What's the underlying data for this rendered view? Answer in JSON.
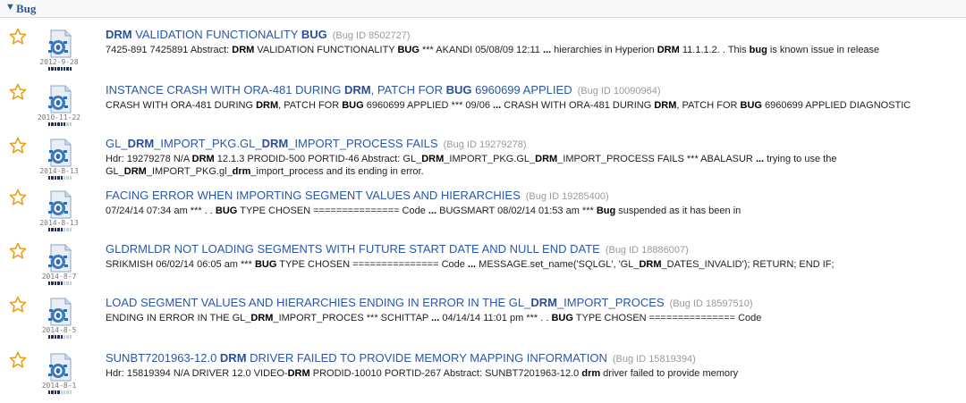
{
  "header": {
    "toggle": "▼",
    "title": "Bug"
  },
  "results": [
    {
      "title": [
        [
          "DRM",
          true
        ],
        [
          " VALIDATION FUNCTIONALITY ",
          false
        ],
        [
          "BUG",
          true
        ]
      ],
      "bug_id": "(Bug ID 8502727)",
      "date": "2012-9-28",
      "relevance": 8,
      "snippet": [
        [
          "7425-891 7425891 Abstract: ",
          false
        ],
        [
          "DRM",
          true
        ],
        [
          " VALIDATION FUNCTIONALITY ",
          false
        ],
        [
          "BUG",
          true
        ],
        [
          " *** AKANDI 05/08/09 12:11 ",
          false
        ],
        [
          "...",
          true
        ],
        [
          " hierarchies in Hyperion ",
          false
        ],
        [
          "DRM",
          true
        ],
        [
          " 11.1.1.2. . This ",
          false
        ],
        [
          "bug",
          true
        ],
        [
          " is known issue in release",
          false
        ]
      ]
    },
    {
      "title": [
        [
          "INSTANCE CRASH WITH ORA-481 DURING ",
          false
        ],
        [
          "DRM",
          true
        ],
        [
          ", PATCH FOR ",
          false
        ],
        [
          "BUG",
          true
        ],
        [
          " 6960699 APPLIED",
          false
        ]
      ],
      "bug_id": "(Bug ID 10090964)",
      "date": "2010-11-22",
      "relevance": 6,
      "snippet": [
        [
          "CRASH WITH ORA-481 DURING ",
          false
        ],
        [
          "DRM",
          true
        ],
        [
          ", PATCH FOR ",
          false
        ],
        [
          "BUG",
          true
        ],
        [
          " 6960699 APPLIED *** 09/06 ",
          false
        ],
        [
          "...",
          true
        ],
        [
          " CRASH WITH ORA-481 DURING ",
          false
        ],
        [
          "DRM",
          true
        ],
        [
          ", PATCH FOR ",
          false
        ],
        [
          "BUG",
          true
        ],
        [
          " 6960699 APPLIED DIAGNOSTIC",
          false
        ]
      ]
    },
    {
      "title": [
        [
          "GL_",
          false
        ],
        [
          "DRM",
          true
        ],
        [
          "_IMPORT_PKG.GL_",
          false
        ],
        [
          "DRM",
          true
        ],
        [
          "_IMPORT_PROCESS FAILS",
          false
        ]
      ],
      "bug_id": "(Bug ID 19279278)",
      "date": "2014-8-13",
      "relevance": 5,
      "snippet": [
        [
          "Hdr: 19279278 N/A ",
          false
        ],
        [
          "DRM",
          true
        ],
        [
          " 12.1.3 PRODID-500 PORTID-46 Abstract: GL_",
          false
        ],
        [
          "DRM",
          true
        ],
        [
          "_IMPORT_PKG.GL_",
          false
        ],
        [
          "DRM",
          true
        ],
        [
          "_IMPORT_PROCESS FAILS *** ABALASUR ",
          false
        ],
        [
          "...",
          true
        ],
        [
          " trying to use the GL_",
          false
        ],
        [
          "DRM",
          true
        ],
        [
          "_IMPORT_PKG.gl_",
          false
        ],
        [
          "drm",
          true
        ],
        [
          "_import_process and its ending in error.",
          false
        ]
      ]
    },
    {
      "title": [
        [
          "FACING ERROR WHEN IMPORTING SEGMENT VALUES AND HIERARCHIES",
          false
        ]
      ],
      "bug_id": "(Bug ID 19285400)",
      "date": "2014-8-13",
      "relevance": 5,
      "snippet": [
        [
          "07/24/14 07:34 am *** . . ",
          false
        ],
        [
          "BUG",
          true
        ],
        [
          " TYPE CHOSEN =============== Code ",
          false
        ],
        [
          "...",
          true
        ],
        [
          " BUGSMART 08/02/14 01:53 am *** ",
          false
        ],
        [
          "Bug",
          true
        ],
        [
          " suspended as it has been in",
          false
        ]
      ]
    },
    {
      "title": [
        [
          "GLDRMLDR NOT LOADING SEGMENTS WITH FUTURE START DATE AND NULL END DATE",
          false
        ]
      ],
      "bug_id": "(Bug ID 18886007)",
      "date": "2014-8-7",
      "relevance": 5,
      "snippet": [
        [
          "SRIKMISH 06/02/14 06:05 am *** ",
          false
        ],
        [
          "BUG",
          true
        ],
        [
          " TYPE CHOSEN =============== Code ",
          false
        ],
        [
          "...",
          true
        ],
        [
          " MESSAGE.set_name('SQLGL', 'GL_",
          false
        ],
        [
          "DRM",
          true
        ],
        [
          "_DATES_INVALID'); RETURN; END IF;",
          false
        ]
      ]
    },
    {
      "title": [
        [
          "LOAD SEGMENT VALUES AND HIERARCHIES ENDING IN ERROR IN THE GL_",
          false
        ],
        [
          "DRM",
          true
        ],
        [
          "_IMPORT_PROCES",
          false
        ]
      ],
      "bug_id": "(Bug ID 18597510)",
      "date": "2014-8-5",
      "relevance": 5,
      "snippet": [
        [
          "ENDING IN ERROR IN THE GL_",
          false
        ],
        [
          "DRM",
          true
        ],
        [
          "_IMPORT_PROCES *** SCHITTAP ",
          false
        ],
        [
          "...",
          true
        ],
        [
          " 04/14/14 11:01 pm *** . . ",
          false
        ],
        [
          "BUG",
          true
        ],
        [
          " TYPE CHOSEN =============== Code",
          false
        ]
      ]
    },
    {
      "title": [
        [
          "SUNBT7201963-12.0 ",
          false
        ],
        [
          "DRM",
          true
        ],
        [
          " DRIVER FAILED TO PROVIDE MEMORY MAPPING INFORMATION",
          false
        ]
      ],
      "bug_id": "(Bug ID 15819394)",
      "date": "2014-8-1",
      "relevance": 4,
      "snippet": [
        [
          "Hdr: 15819394 N/A DRIVER 12.0 VIDEO-",
          false
        ],
        [
          "DRM",
          true
        ],
        [
          " PRODID-10010 PORTID-267 Abstract: SUNBT7201963-12.0 ",
          false
        ],
        [
          "drm",
          true
        ],
        [
          " driver failed to provide memory",
          false
        ]
      ]
    }
  ],
  "colors": {
    "link": "#2b57a8",
    "star": "#e8a21e",
    "doc_blue": "#2c6db7"
  }
}
